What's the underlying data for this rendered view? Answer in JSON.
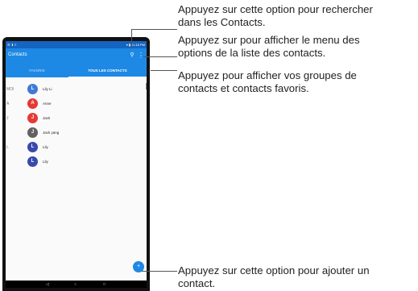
{
  "device": {
    "status_left": "☰ ⬇ ≡",
    "status_right": "▾ ▮ 11:18 PM",
    "app_title": "Contacts",
    "tabs": [
      {
        "label": "FAVORIS"
      },
      {
        "label": "TOUS LES CONTACTS"
      }
    ],
    "contacts": [
      {
        "section": "MOI",
        "initial": "L",
        "name": "Lily Li",
        "color": "#3f7ad6"
      },
      {
        "section": "A",
        "initial": "A",
        "name": "Anne",
        "color": "#e53935"
      },
      {
        "section": "J",
        "initial": "J",
        "name": "Jack",
        "color": "#e53935"
      },
      {
        "section": "",
        "initial": "J",
        "name": "Jack yang",
        "color": "#616161"
      },
      {
        "section": "L",
        "initial": "L",
        "name": "Lily",
        "color": "#3949ab"
      },
      {
        "section": "",
        "initial": "L",
        "name": "Lily",
        "color": "#3949ab"
      }
    ],
    "icons": {
      "search": "search-icon",
      "menu": "more-vert-icon",
      "fab": "add-contact-icon",
      "back": "back-icon",
      "home": "home-icon",
      "recents": "recents-icon"
    }
  },
  "callouts": {
    "search_1": "Appuyez sur cette option pour rechercher",
    "search_2": "dans les Contacts.",
    "menu_1": "Appuyez sur pour afficher le menu des",
    "menu_2": "options de la liste des contacts.",
    "tabs_1": "Appuyez pour afficher vos groupes de",
    "tabs_2": "contacts et contacts favoris.",
    "fab_1": "Appuyez sur cette option pour ajouter un",
    "fab_2": "contact."
  }
}
